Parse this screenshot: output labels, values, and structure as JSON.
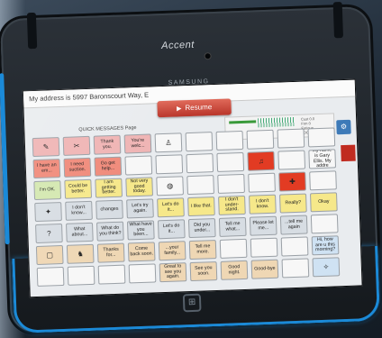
{
  "device": {
    "brand_text": "Accent",
    "maker_text": "SAMSUNG",
    "home_icon": "windows-home-icon"
  },
  "screen": {
    "message_bar": "My address is 5997 Baronscourt Way, E",
    "resume_label": "Resume",
    "page_label": "QUICK MESSAGES Page",
    "status_stats": [
      "Cust 0.0",
      "Frm 0",
      "Fatigue",
      "LOCK"
    ],
    "settings_icon": "settings-icon"
  },
  "cells": [
    {
      "t": "",
      "icon": "pen-icon",
      "c": "c-pink"
    },
    {
      "t": "",
      "icon": "tools-icon",
      "c": "c-pink"
    },
    {
      "t": "Thank you.",
      "c": "c-pink"
    },
    {
      "t": "You're welc...",
      "c": "c-pink"
    },
    {
      "t": "",
      "icon": "person-icon",
      "c": "c-white"
    },
    {
      "t": "",
      "c": "c-white"
    },
    {
      "t": "",
      "c": "c-white"
    },
    {
      "t": "",
      "c": "c-white"
    },
    {
      "t": "",
      "c": "c-white"
    },
    {
      "t": "",
      "c": "c-white"
    },
    {
      "t": "I have an em...",
      "c": "c-salmon"
    },
    {
      "t": "I need suction.",
      "c": "c-salmon"
    },
    {
      "t": "Go get help...",
      "c": "c-salmon"
    },
    {
      "t": "",
      "c": "c-white"
    },
    {
      "t": "",
      "c": "c-white"
    },
    {
      "t": "",
      "c": "c-white"
    },
    {
      "t": "",
      "c": "c-white"
    },
    {
      "t": "",
      "icon": "bell-icon",
      "c": "c-red"
    },
    {
      "t": "",
      "c": "c-white"
    },
    {
      "t": "My name is Gary Ellis. My addre",
      "c": "c-white"
    },
    {
      "t": "I'm OK.",
      "c": "c-green"
    },
    {
      "t": "Could be better.",
      "c": "c-yellow"
    },
    {
      "t": "I am getting better.",
      "c": "c-yellow"
    },
    {
      "t": "Not very good today.",
      "c": "c-yellow"
    },
    {
      "t": "",
      "icon": "horn-icon",
      "c": "c-white"
    },
    {
      "t": "",
      "c": "c-white"
    },
    {
      "t": "",
      "c": "c-white"
    },
    {
      "t": "",
      "c": "c-white"
    },
    {
      "t": "",
      "icon": "ambulance-icon",
      "c": "c-red"
    },
    {
      "t": "",
      "c": "c-white"
    },
    {
      "t": "",
      "icon": "wrench-icon",
      "c": "c-gray"
    },
    {
      "t": "I don't know...",
      "c": "c-gray"
    },
    {
      "t": "changes",
      "c": "c-gray"
    },
    {
      "t": "Let's try again.",
      "c": "c-gray"
    },
    {
      "t": "Let's do it...",
      "c": "c-yellow"
    },
    {
      "t": "I like that.",
      "c": "c-yellow"
    },
    {
      "t": "I don't under-stand.",
      "c": "c-yellow"
    },
    {
      "t": "I don't know.",
      "c": "c-yellow"
    },
    {
      "t": "Really?",
      "c": "c-yellow"
    },
    {
      "t": "Okay",
      "c": "c-yellow"
    },
    {
      "t": "",
      "icon": "question-icon",
      "c": "c-gray"
    },
    {
      "t": "What about...",
      "c": "c-gray"
    },
    {
      "t": "What do you think?",
      "c": "c-gray"
    },
    {
      "t": "What have you been...",
      "c": "c-gray"
    },
    {
      "t": "Let's do it...",
      "c": "c-gray"
    },
    {
      "t": "Did you under...",
      "c": "c-gray"
    },
    {
      "t": "Tell me what...",
      "c": "c-gray"
    },
    {
      "t": "Please let me...",
      "c": "c-gray"
    },
    {
      "t": "...tell me again",
      "c": "c-gray"
    },
    {
      "t": "",
      "c": "c-white"
    },
    {
      "t": "",
      "icon": "square-icon",
      "c": "c-tan"
    },
    {
      "t": "",
      "icon": "boot-icon",
      "c": "c-tan"
    },
    {
      "t": "Thanks for...",
      "c": "c-tan"
    },
    {
      "t": "Come back soon.",
      "c": "c-tan"
    },
    {
      "t": "...your family...",
      "c": "c-tan"
    },
    {
      "t": "Tell me more.",
      "c": "c-tan"
    },
    {
      "t": "",
      "c": "c-white"
    },
    {
      "t": "",
      "c": "c-white"
    },
    {
      "t": "",
      "c": "c-white"
    },
    {
      "t": "Hi, how are u this morning?",
      "c": "c-blue"
    },
    {
      "t": "",
      "c": "c-white"
    },
    {
      "t": "",
      "c": "c-white"
    },
    {
      "t": "",
      "c": "c-white"
    },
    {
      "t": "",
      "c": "c-white"
    },
    {
      "t": "Great to see you again.",
      "c": "c-tan"
    },
    {
      "t": "See you soon.",
      "c": "c-tan"
    },
    {
      "t": "Good night.",
      "c": "c-tan"
    },
    {
      "t": "Good-bye",
      "c": "c-tan"
    },
    {
      "t": "",
      "c": "c-white"
    },
    {
      "t": "",
      "icon": "compass-icon",
      "c": "c-blue"
    }
  ]
}
